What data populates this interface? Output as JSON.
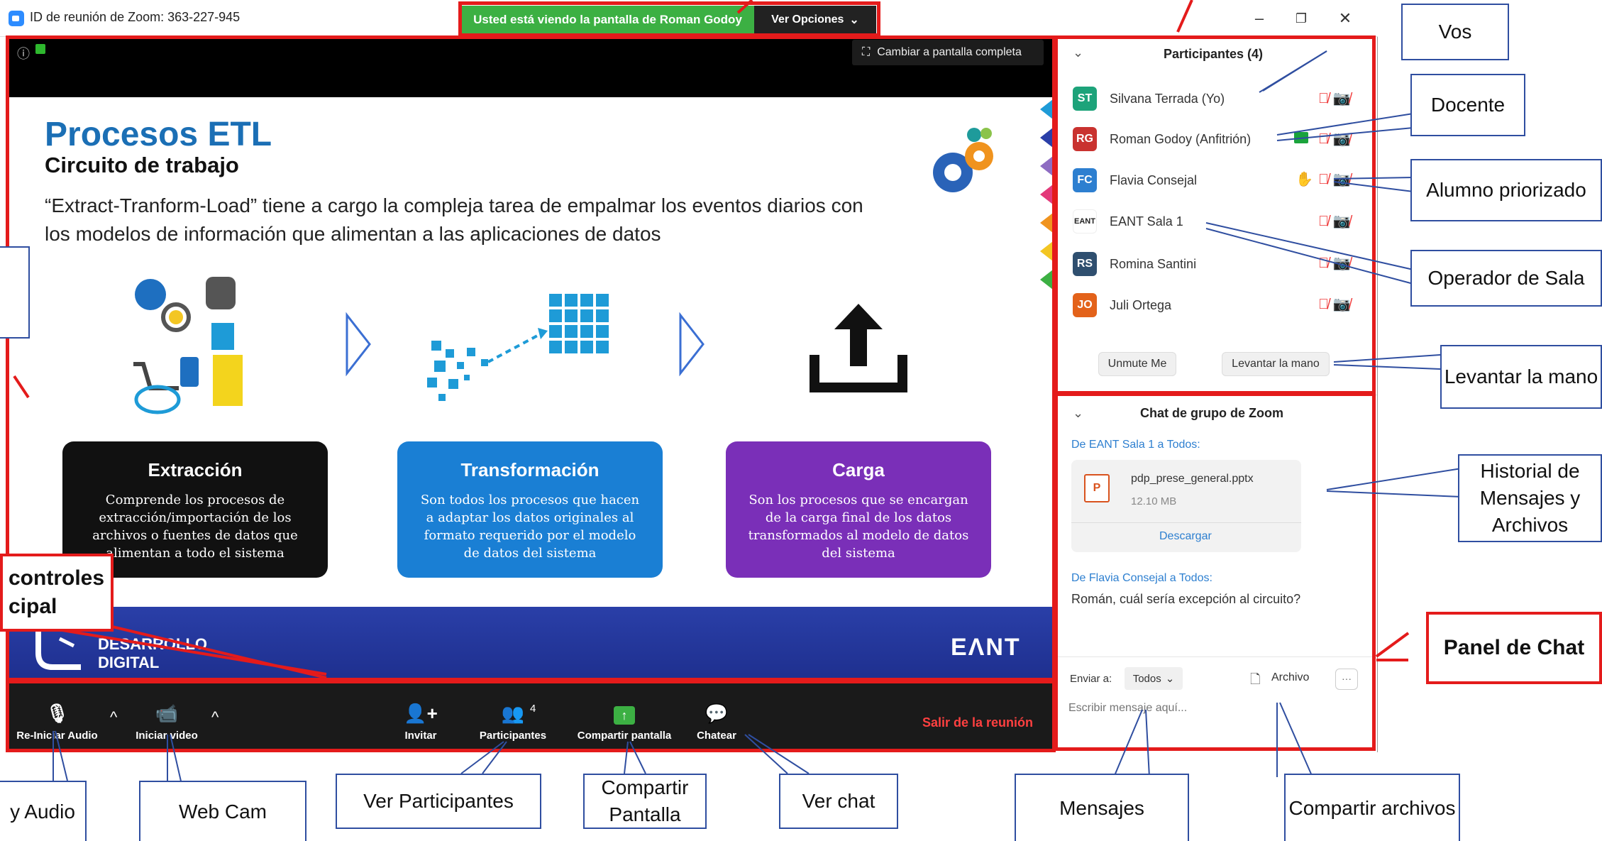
{
  "window": {
    "title": "ID de reunión de Zoom: 363-227-945",
    "share_banner": "Usted está viendo la pantalla de Roman Godoy",
    "view_options": "Ver Opciones"
  },
  "video": {
    "fullscreen_label": "Cambiar a pantalla completa"
  },
  "slide": {
    "title": "Procesos ETL",
    "subtitle": "Circuito de trabajo",
    "description": "“Extract-Tranform-Load” tiene a cargo la compleja tarea de empalmar los eventos diarios con los modelos de información que alimentan a las aplicaciones de datos",
    "cards": [
      {
        "title": "Extracción",
        "text": "Comprende los procesos de extracción/importación de los archivos o fuentes de datos que alimentan a todo el sistema",
        "color": "#111111"
      },
      {
        "title": "Transformación",
        "text": "Son todos los procesos que hacen a adaptar los datos originales al formato requerido por el modelo de datos del sistema",
        "color": "#1a7fd4"
      },
      {
        "title": "Carga",
        "text": "Son los procesos que se encargan de la carga final de los datos transformados al modelo de datos del sistema",
        "color": "#7a2fb8"
      }
    ],
    "footer_left": "DESARROLLO\nDIGITAL",
    "footer_right": "EΛNT"
  },
  "toolbar": {
    "audio": "Re-Iniciar Audio",
    "video": "Iniciar video",
    "invite": "Invitar",
    "participants": "Participantes",
    "participants_count": "4",
    "share": "Compartir pantalla",
    "chat": "Chatear",
    "leave": "Salir de la reunión"
  },
  "participants_panel": {
    "header": "Participantes (4)",
    "people": [
      {
        "initials": "ST",
        "name": "Silvana Terrada (Yo)",
        "color": "#1da37a"
      },
      {
        "initials": "RG",
        "name": "Roman Godoy (Anfitrión)",
        "color": "#c9322f"
      },
      {
        "initials": "FC",
        "name": "Flavia Consejal",
        "color": "#2d7fd0"
      },
      {
        "initials": "EANT",
        "name": "EANT Sala 1",
        "color": "#ffffff"
      },
      {
        "initials": "RS",
        "name": "Romina Santini",
        "color": "#2f4f6f"
      },
      {
        "initials": "JO",
        "name": "Juli Ortega",
        "color": "#e3621a"
      }
    ],
    "unmute": "Unmute Me",
    "raise_hand": "Levantar la mano"
  },
  "chat_panel": {
    "header": "Chat de grupo de Zoom",
    "msg1_from": "De EANT Sala 1 a Todos:",
    "file_name": "pdp_prese_general.pptx",
    "file_size": "12.10 MB",
    "download": "Descargar",
    "msg2_from": "De Flavia Consejal a Todos:",
    "msg2_text": "Román, cuál sería excepción al circuito?",
    "send_to_label": "Enviar a:",
    "send_to_value": "Todos",
    "file_button": "Archivo",
    "more": "···",
    "input_placeholder": "Escribir mensaje aquí..."
  },
  "annotations": {
    "vos": "Vos",
    "docente": "Docente",
    "priorizado": "Alumno priorizado",
    "operador": "Operador de Sala",
    "levantar": "Levantar la mano",
    "historial": "Historial de Mensajes y Archivos",
    "panel_chat": "Panel de Chat",
    "controles": "controles\ncipal",
    "audio": "y Audio",
    "webcam": "Web Cam",
    "ver_participantes": "Ver Participantes",
    "compartir": "Compartir Pantalla",
    "ver_chat": "Ver chat",
    "mensajes": "Mensajes",
    "compartir_archivos": "Compartir archivos"
  }
}
